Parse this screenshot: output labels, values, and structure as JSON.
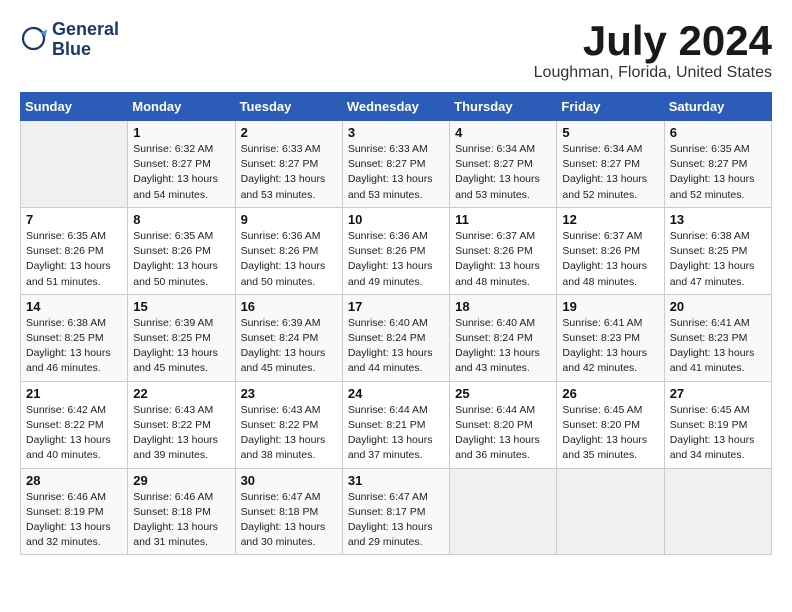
{
  "header": {
    "logo_line1": "General",
    "logo_line2": "Blue",
    "month": "July 2024",
    "location": "Loughman, Florida, United States"
  },
  "weekdays": [
    "Sunday",
    "Monday",
    "Tuesday",
    "Wednesday",
    "Thursday",
    "Friday",
    "Saturday"
  ],
  "weeks": [
    [
      {
        "day": "",
        "info": ""
      },
      {
        "day": "1",
        "info": "Sunrise: 6:32 AM\nSunset: 8:27 PM\nDaylight: 13 hours\nand 54 minutes."
      },
      {
        "day": "2",
        "info": "Sunrise: 6:33 AM\nSunset: 8:27 PM\nDaylight: 13 hours\nand 53 minutes."
      },
      {
        "day": "3",
        "info": "Sunrise: 6:33 AM\nSunset: 8:27 PM\nDaylight: 13 hours\nand 53 minutes."
      },
      {
        "day": "4",
        "info": "Sunrise: 6:34 AM\nSunset: 8:27 PM\nDaylight: 13 hours\nand 53 minutes."
      },
      {
        "day": "5",
        "info": "Sunrise: 6:34 AM\nSunset: 8:27 PM\nDaylight: 13 hours\nand 52 minutes."
      },
      {
        "day": "6",
        "info": "Sunrise: 6:35 AM\nSunset: 8:27 PM\nDaylight: 13 hours\nand 52 minutes."
      }
    ],
    [
      {
        "day": "7",
        "info": "Sunrise: 6:35 AM\nSunset: 8:26 PM\nDaylight: 13 hours\nand 51 minutes."
      },
      {
        "day": "8",
        "info": "Sunrise: 6:35 AM\nSunset: 8:26 PM\nDaylight: 13 hours\nand 50 minutes."
      },
      {
        "day": "9",
        "info": "Sunrise: 6:36 AM\nSunset: 8:26 PM\nDaylight: 13 hours\nand 50 minutes."
      },
      {
        "day": "10",
        "info": "Sunrise: 6:36 AM\nSunset: 8:26 PM\nDaylight: 13 hours\nand 49 minutes."
      },
      {
        "day": "11",
        "info": "Sunrise: 6:37 AM\nSunset: 8:26 PM\nDaylight: 13 hours\nand 48 minutes."
      },
      {
        "day": "12",
        "info": "Sunrise: 6:37 AM\nSunset: 8:26 PM\nDaylight: 13 hours\nand 48 minutes."
      },
      {
        "day": "13",
        "info": "Sunrise: 6:38 AM\nSunset: 8:25 PM\nDaylight: 13 hours\nand 47 minutes."
      }
    ],
    [
      {
        "day": "14",
        "info": "Sunrise: 6:38 AM\nSunset: 8:25 PM\nDaylight: 13 hours\nand 46 minutes."
      },
      {
        "day": "15",
        "info": "Sunrise: 6:39 AM\nSunset: 8:25 PM\nDaylight: 13 hours\nand 45 minutes."
      },
      {
        "day": "16",
        "info": "Sunrise: 6:39 AM\nSunset: 8:24 PM\nDaylight: 13 hours\nand 45 minutes."
      },
      {
        "day": "17",
        "info": "Sunrise: 6:40 AM\nSunset: 8:24 PM\nDaylight: 13 hours\nand 44 minutes."
      },
      {
        "day": "18",
        "info": "Sunrise: 6:40 AM\nSunset: 8:24 PM\nDaylight: 13 hours\nand 43 minutes."
      },
      {
        "day": "19",
        "info": "Sunrise: 6:41 AM\nSunset: 8:23 PM\nDaylight: 13 hours\nand 42 minutes."
      },
      {
        "day": "20",
        "info": "Sunrise: 6:41 AM\nSunset: 8:23 PM\nDaylight: 13 hours\nand 41 minutes."
      }
    ],
    [
      {
        "day": "21",
        "info": "Sunrise: 6:42 AM\nSunset: 8:22 PM\nDaylight: 13 hours\nand 40 minutes."
      },
      {
        "day": "22",
        "info": "Sunrise: 6:43 AM\nSunset: 8:22 PM\nDaylight: 13 hours\nand 39 minutes."
      },
      {
        "day": "23",
        "info": "Sunrise: 6:43 AM\nSunset: 8:22 PM\nDaylight: 13 hours\nand 38 minutes."
      },
      {
        "day": "24",
        "info": "Sunrise: 6:44 AM\nSunset: 8:21 PM\nDaylight: 13 hours\nand 37 minutes."
      },
      {
        "day": "25",
        "info": "Sunrise: 6:44 AM\nSunset: 8:20 PM\nDaylight: 13 hours\nand 36 minutes."
      },
      {
        "day": "26",
        "info": "Sunrise: 6:45 AM\nSunset: 8:20 PM\nDaylight: 13 hours\nand 35 minutes."
      },
      {
        "day": "27",
        "info": "Sunrise: 6:45 AM\nSunset: 8:19 PM\nDaylight: 13 hours\nand 34 minutes."
      }
    ],
    [
      {
        "day": "28",
        "info": "Sunrise: 6:46 AM\nSunset: 8:19 PM\nDaylight: 13 hours\nand 32 minutes."
      },
      {
        "day": "29",
        "info": "Sunrise: 6:46 AM\nSunset: 8:18 PM\nDaylight: 13 hours\nand 31 minutes."
      },
      {
        "day": "30",
        "info": "Sunrise: 6:47 AM\nSunset: 8:18 PM\nDaylight: 13 hours\nand 30 minutes."
      },
      {
        "day": "31",
        "info": "Sunrise: 6:47 AM\nSunset: 8:17 PM\nDaylight: 13 hours\nand 29 minutes."
      },
      {
        "day": "",
        "info": ""
      },
      {
        "day": "",
        "info": ""
      },
      {
        "day": "",
        "info": ""
      }
    ]
  ]
}
